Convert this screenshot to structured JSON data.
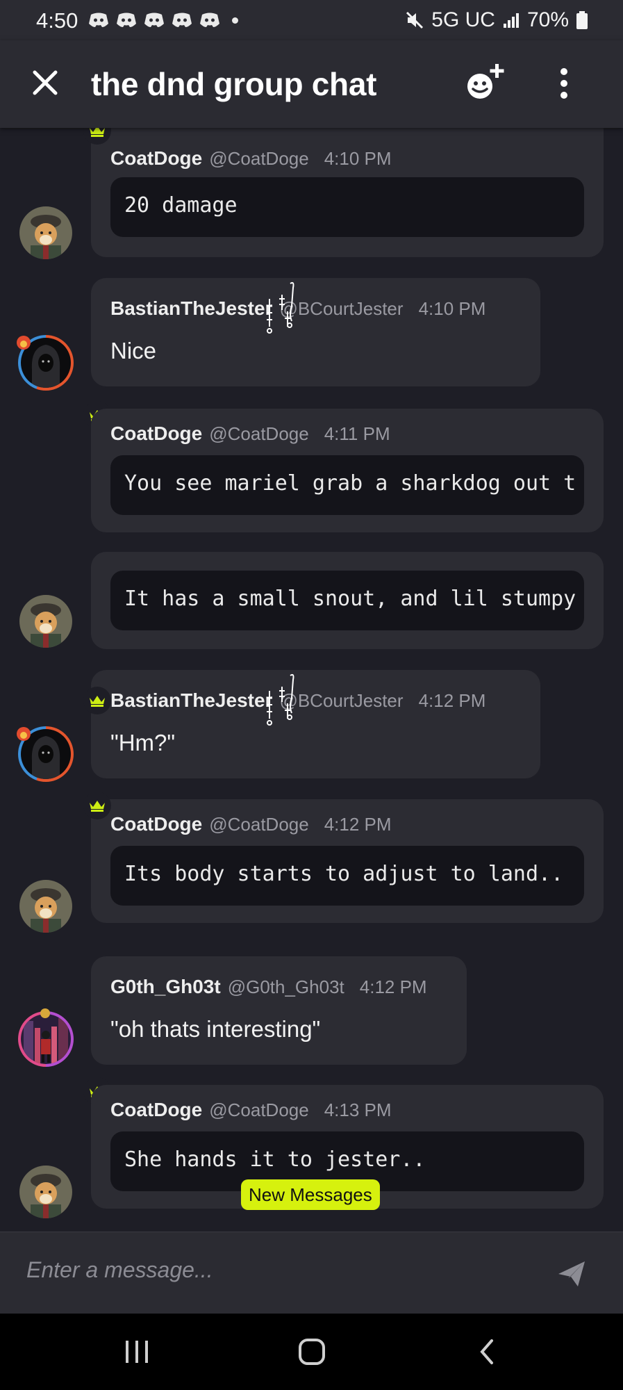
{
  "status_bar": {
    "time": "4:50",
    "notification_icons": [
      "discord-icon",
      "discord-icon",
      "discord-icon",
      "discord-icon",
      "discord-icon"
    ],
    "network": "5G UC",
    "battery": "70%"
  },
  "header": {
    "title": "the dnd group chat"
  },
  "messages": [
    {
      "name": "CoatDoge",
      "handle": "@CoatDoge",
      "time": "4:10 PM",
      "code": "20 damage"
    },
    {
      "name": "BastianTheJester",
      "handle": "@BCourtJester",
      "time": "4:10 PM",
      "text": "Nice"
    },
    {
      "name": "CoatDoge",
      "handle": "@CoatDoge",
      "time": "4:11 PM",
      "code": "You see mariel grab a sharkdog out t"
    },
    {
      "code": "It has a small snout, and lil stumpy"
    },
    {
      "name": "BastianTheJester",
      "handle": "@BCourtJester",
      "time": "4:12 PM",
      "text": "\"Hm?\""
    },
    {
      "name": "CoatDoge",
      "handle": "@CoatDoge",
      "time": "4:12 PM",
      "code": "Its body starts to adjust to land.."
    },
    {
      "name": "G0th_Gh03t",
      "handle": "@G0th_Gh03t",
      "time": "4:12 PM",
      "text": "\"oh thats interesting\""
    },
    {
      "name": "CoatDoge",
      "handle": "@CoatDoge",
      "time": "4:13 PM",
      "code": "She hands it to jester.."
    }
  ],
  "new_messages_label": "New Messages",
  "composer": {
    "placeholder": "Enter a message..."
  },
  "colors": {
    "background": "#1e1e26",
    "bubble": "#2c2c33",
    "code_block": "#14141a",
    "crown": "#cdee14",
    "new_messages_pill": "#d6f10e"
  }
}
